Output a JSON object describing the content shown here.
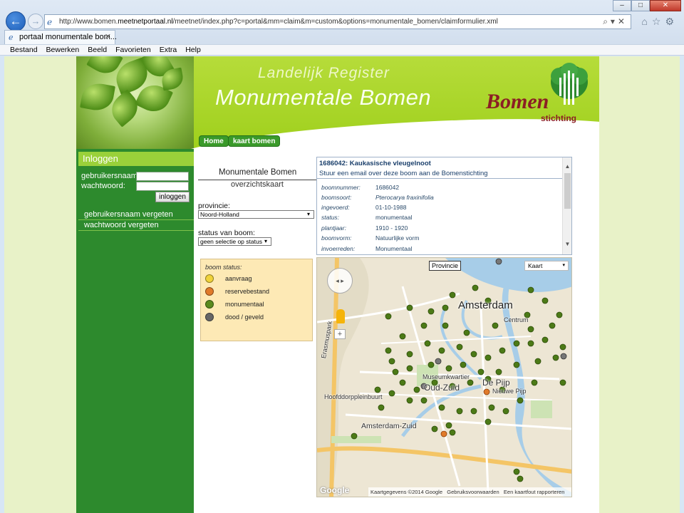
{
  "browser": {
    "url_prefix": "http://www.bomen.",
    "url_domain": "meetnetportaal.nl",
    "url_rest": "/meetnet/index.php?c=portal&mm=claim&m=custom&options=monumentale_bomen/claimformulier.xml",
    "tab_title": "portaal monumentale bom...",
    "menu": [
      "Bestand",
      "Bewerken",
      "Beeld",
      "Favorieten",
      "Extra",
      "Help"
    ]
  },
  "header": {
    "title_line1": "Landelijk Register",
    "title_line2": "Monumentale Bomen",
    "logo_main": "Bomen",
    "logo_sub": "stichting"
  },
  "nav": {
    "home": "Home",
    "map": "kaart bomen"
  },
  "login": {
    "heading": "Inloggen",
    "username_label": "gebruikersnaam:",
    "password_label": "wachtwoord:",
    "submit": "inloggen",
    "forgot_username": "gebruikersnaam vergeten",
    "forgot_password": "wachtwoord vergeten"
  },
  "overview": {
    "title": "Monumentale Bomen",
    "subtitle": "overzichtskaart",
    "province_label": "provincie:",
    "province_value": "Noord-Holland",
    "status_label": "status van boom:",
    "status_value": "geen selectie op status"
  },
  "legend": {
    "title": "boom status:",
    "items": [
      {
        "label": "aanvraag",
        "color": "#f0d23a"
      },
      {
        "label": "reservebestand",
        "color": "#e07a2a"
      },
      {
        "label": "monumentaal",
        "color": "#5a8a1e"
      },
      {
        "label": "dood / geveld",
        "color": "#666666"
      }
    ]
  },
  "tree_info": {
    "title": "1686042: Kaukasische vleugelnoot",
    "email_link": "Stuur een email over deze boom aan de Bomenstichting",
    "rows": [
      {
        "key": "boomnummer:",
        "value": "1686042"
      },
      {
        "key": "boomsoort:",
        "value": "Pterocarya fraxinifolia"
      },
      {
        "key": "ingevoerd:",
        "value": "01-10-1988"
      },
      {
        "key": "status:",
        "value": "monumentaal"
      },
      {
        "key": "plantjaar:",
        "value": "1910 - 1920"
      },
      {
        "key": "boomvorm:",
        "value": "Natuurlijke vorm"
      },
      {
        "key": "invoerreden:",
        "value": "Monumentaal"
      }
    ]
  },
  "map": {
    "provincie_btn": "Provincie",
    "type": "Kaart",
    "city": "Amsterdam",
    "districts": [
      "Museumkwartier",
      "Oud-Zuid",
      "Amsterdam-Zuid",
      "De Pijp",
      "Nieuwe Pijp",
      "Hoofddorppleinbuurt",
      "Centrum",
      "Erasmuspark"
    ],
    "attribution": "Kaartgegevens ©2014 Google",
    "terms": "Gebruiksvoorwaarden",
    "report": "Een kaartfout rapporteren",
    "google": "Google"
  }
}
